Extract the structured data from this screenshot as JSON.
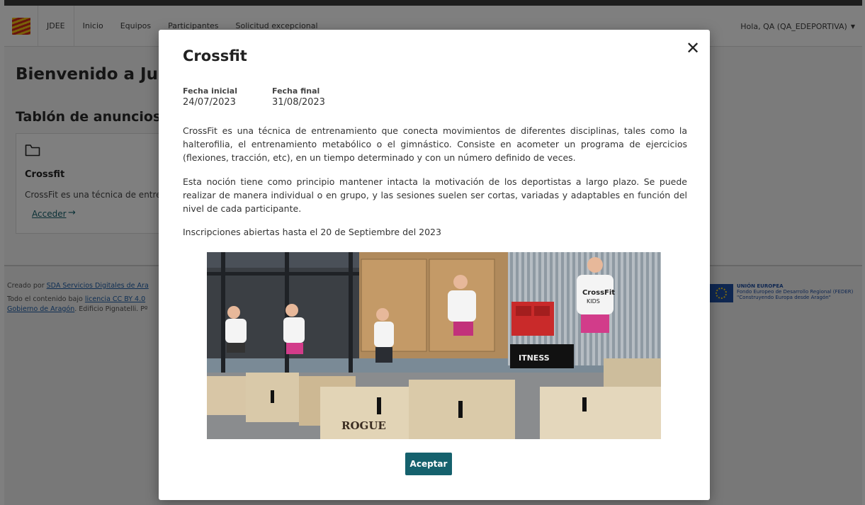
{
  "navbar": {
    "brand": "JDEE",
    "items": [
      "Inicio",
      "Equipos",
      "Participantes",
      "Solicitud excepcional"
    ],
    "user_greeting": "Hola, QA (QA_EDEPORTIVA)"
  },
  "page": {
    "welcome_title": "Bienvenido a Jueg",
    "board_title": "Tablón de anuncios",
    "card": {
      "title": "Crossfit",
      "excerpt": "CrossFit es una técnica de entren",
      "link_label": "Acceder",
      "link_arrow": "→"
    }
  },
  "footer": {
    "line1_prefix": "Creado por ",
    "line1_link": "SDA Servicios Digitales de Ara",
    "line2_prefix": "Todo el contenido bajo ",
    "line2_link": "licencia CC BY 4.0",
    "line3_link": "Gobierno de Aragón",
    "line3_suffix": ". Edificio Pignatelli. Pº",
    "eu_title": "UNIÓN EUROPEA",
    "eu_line2": "Fondo Europeo de Desarrollo Regional (FEDER)",
    "eu_line3": "\"Construyendo Europa desde Aragón\""
  },
  "modal": {
    "title": "Crossfit",
    "close_symbol": "✕",
    "start_label": "Fecha inicial",
    "start_value": "24/07/2023",
    "end_label": "Fecha final",
    "end_value": "31/08/2023",
    "paragraph1": "CrossFit es una técnica de entrenamiento que conecta movimientos de diferentes disciplinas, tales como la halterofilia, el entrenamiento metabólico o el gimnástico. Consiste en acometer un programa de ejercicios (flexiones, tracción, etc), en un tiempo determinado y con un número definido de veces.",
    "paragraph2": "Esta noción tiene como principio mantener intacta la motivación de los deportistas a largo plazo. Se puede realizar de manera individual o en grupo, y las sesiones suelen ser cortas, variadas y adaptables en función del nivel de cada participante.",
    "inscripciones": "Inscripciones abiertas hasta el 20 de Septiembre del 2023",
    "photo_text": {
      "box_brand": "ROGUE",
      "shirt_brand": "CrossFit",
      "shirt_sub": "KIDS",
      "banner": "ITNESS"
    },
    "accept_label": "Aceptar"
  }
}
